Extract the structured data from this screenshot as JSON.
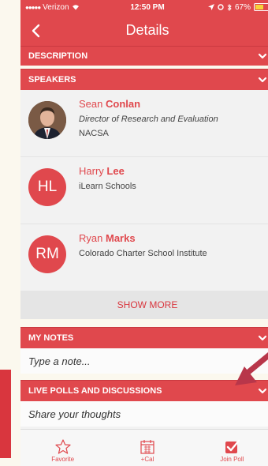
{
  "status_bar": {
    "carrier": "Verizon",
    "time": "12:50 PM",
    "battery": "67%"
  },
  "nav": {
    "title": "Details"
  },
  "sections": {
    "description": "DESCRIPTION",
    "speakers": "SPEAKERS",
    "my_notes": "MY NOTES",
    "live_polls": "LIVE POLLS AND DISCUSSIONS"
  },
  "speakers": [
    {
      "first": "Sean",
      "last": "Conlan",
      "title": "Director of Research and Evaluation",
      "org": "NACSA",
      "initials": ""
    },
    {
      "first": "Harry",
      "last": "Lee",
      "title": "",
      "org": "iLearn Schools",
      "initials": "HL"
    },
    {
      "first": "Ryan",
      "last": "Marks",
      "title": "",
      "org": "Colorado Charter School Institute",
      "initials": "RM"
    }
  ],
  "show_more": "SHOW MORE",
  "notes": {
    "placeholder": "Type a note..."
  },
  "polls": {
    "placeholder": "Share your thoughts"
  },
  "tabs": {
    "favorite": "Favorite",
    "cal": "+Cal",
    "join_poll": "Join Poll"
  },
  "colors": {
    "accent": "#e0484d",
    "annotation_arrow": "#b8364a"
  }
}
